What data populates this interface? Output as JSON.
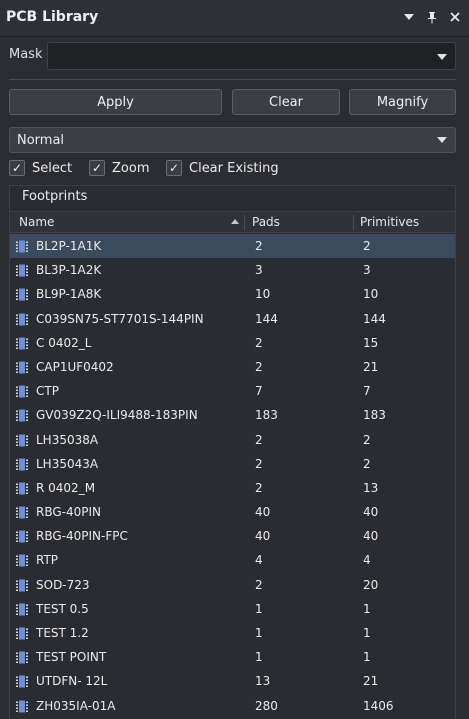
{
  "panel": {
    "title": "PCB Library"
  },
  "mask": {
    "label": "Mask",
    "value": "",
    "placeholder": ""
  },
  "buttons": {
    "apply": "Apply",
    "clear": "Clear",
    "magnify": "Magnify"
  },
  "mode": {
    "selected": "Normal"
  },
  "options": {
    "select": {
      "label": "Select",
      "checked": true
    },
    "zoom": {
      "label": "Zoom",
      "checked": true
    },
    "clear_existing": {
      "label": "Clear Existing",
      "checked": true
    }
  },
  "footprints": {
    "title": "Footprints",
    "columns": {
      "name": "Name",
      "pads": "Pads",
      "primitives": "Primitives"
    },
    "sort": {
      "column": "Name",
      "direction": "ascending"
    },
    "selected_row": 0,
    "rows": [
      {
        "name": "BL2P-1A1K",
        "pads": "2",
        "primitives": "2"
      },
      {
        "name": "BL3P-1A2K",
        "pads": "3",
        "primitives": "3"
      },
      {
        "name": "BL9P-1A8K",
        "pads": "10",
        "primitives": "10"
      },
      {
        "name": "C039SN75-ST7701S-144PIN",
        "pads": "144",
        "primitives": "144"
      },
      {
        "name": "C 0402_L",
        "pads": "2",
        "primitives": "15"
      },
      {
        "name": "CAP1UF0402",
        "pads": "2",
        "primitives": "21"
      },
      {
        "name": "CTP",
        "pads": "7",
        "primitives": "7"
      },
      {
        "name": "GV039Z2Q-ILI9488-183PIN",
        "pads": "183",
        "primitives": "183"
      },
      {
        "name": "LH35038A",
        "pads": "2",
        "primitives": "2"
      },
      {
        "name": "LH35043A",
        "pads": "2",
        "primitives": "2"
      },
      {
        "name": "R 0402_M",
        "pads": "2",
        "primitives": "13"
      },
      {
        "name": "RBG-40PIN",
        "pads": "40",
        "primitives": "40"
      },
      {
        "name": "RBG-40PIN-FPC",
        "pads": "40",
        "primitives": "40"
      },
      {
        "name": "RTP",
        "pads": "4",
        "primitives": "4"
      },
      {
        "name": "SOD-723",
        "pads": "2",
        "primitives": "20"
      },
      {
        "name": "TEST 0.5",
        "pads": "1",
        "primitives": "1"
      },
      {
        "name": "TEST 1.2",
        "pads": "1",
        "primitives": "1"
      },
      {
        "name": "TEST POINT",
        "pads": "1",
        "primitives": "1"
      },
      {
        "name": "UTDFN- 12L",
        "pads": "13",
        "primitives": "21"
      },
      {
        "name": "ZH035IA-01A",
        "pads": "280",
        "primitives": "1406"
      }
    ]
  },
  "colors": {
    "background": "#2b2d33",
    "selected_row": "#3c4a5e",
    "footprint_icon": "#6f8fd6"
  },
  "icons": {
    "dropdown": "chevron-down-icon",
    "pin": "pin-icon",
    "close": "close-icon",
    "check": "check-icon",
    "footprint": "footprint-icon"
  }
}
